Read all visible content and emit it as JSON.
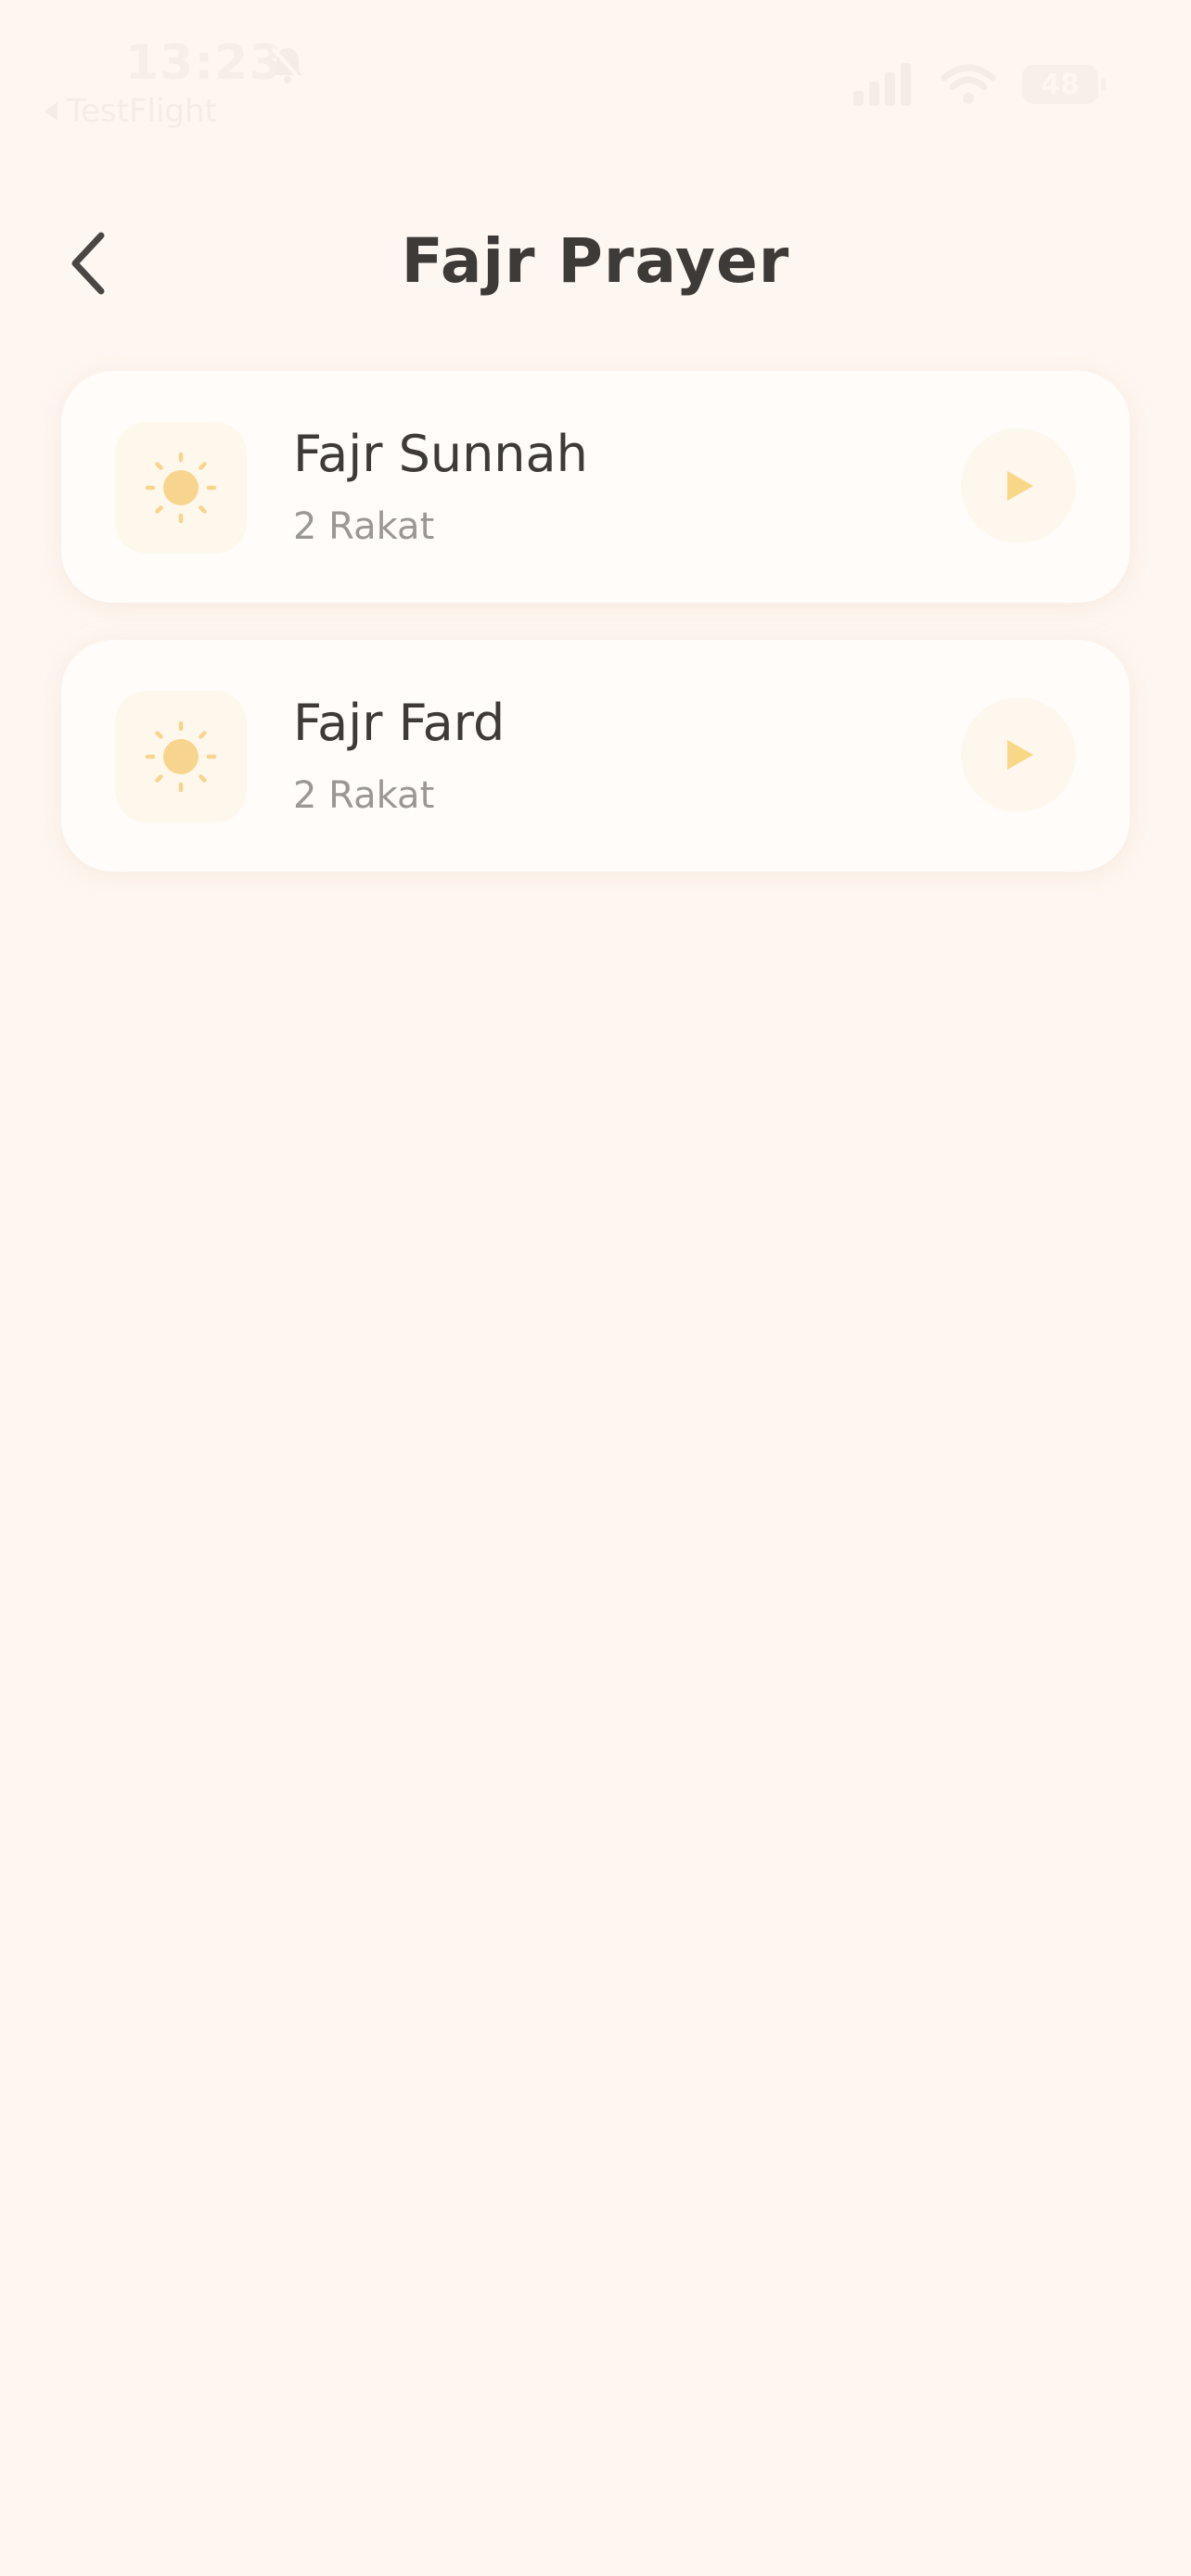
{
  "status_bar": {
    "time": "13:23",
    "back_app_label": "TestFlight",
    "battery": "48"
  },
  "header": {
    "title": "Fajr Prayer"
  },
  "prayers": [
    {
      "title": "Fajr Sunnah",
      "subtitle": "2 Rakat",
      "icon": "sun-icon"
    },
    {
      "title": "Fajr Fard",
      "subtitle": "2 Rakat",
      "icon": "sun-icon"
    }
  ],
  "colors": {
    "background": "#FEF6F0",
    "card": "#FFFCFA",
    "accent_sun": "#F7D58F",
    "play": "#F8D886",
    "title_text": "#3D3A38",
    "subtitle_text": "#9A9794"
  }
}
